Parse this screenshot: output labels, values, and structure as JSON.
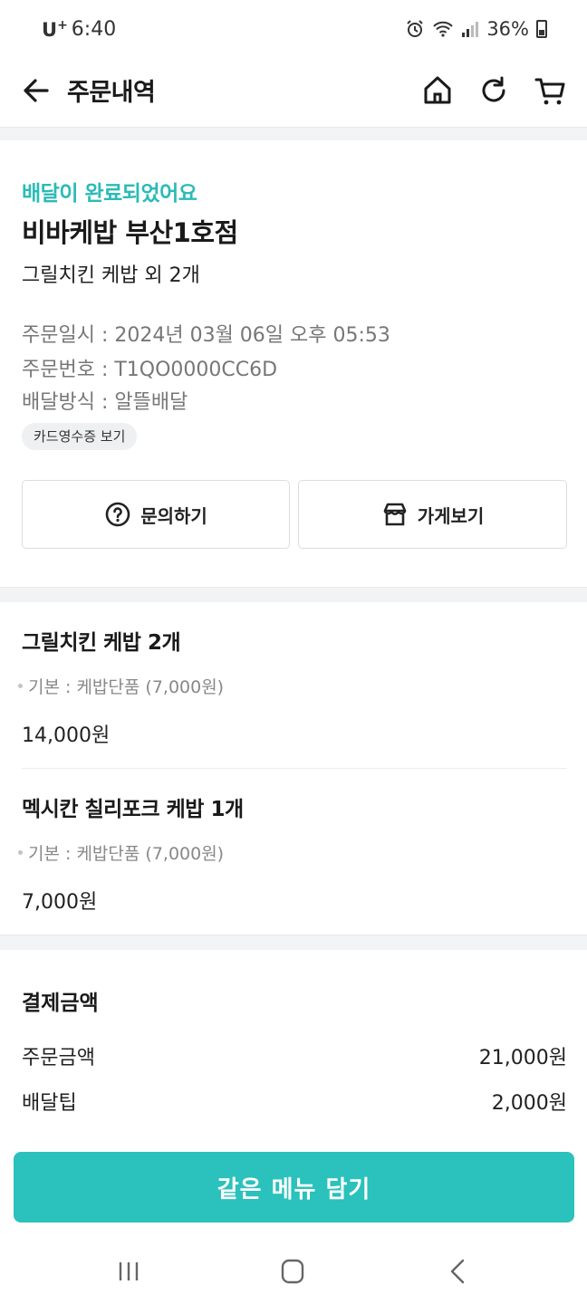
{
  "status_bar": {
    "carrier": "U",
    "carrier_plus": "+",
    "time": "6:40",
    "battery": "36%"
  },
  "header": {
    "title": "주문내역",
    "icons": [
      "back-icon",
      "home-icon",
      "refresh-icon",
      "cart-icon"
    ]
  },
  "order": {
    "status": "배달이 완료되었어요",
    "store_name": "비바케밥 부산1호점",
    "summary": "그릴치킨 케밥 외 2개",
    "info": [
      {
        "label": "주문일시 : ",
        "value": "2024년 03월 06일 오후 05:53"
      },
      {
        "label": "주문번호 : ",
        "value": "T1QO0000CC6D"
      },
      {
        "label": "배달방식 : ",
        "value": "알뜰배달"
      }
    ],
    "receipt_button": "카드영수증 보기",
    "inquiry_button": "문의하기",
    "store_button": "가게보기"
  },
  "items": [
    {
      "name": "그릴치킨 케밥 2개",
      "option": "기본 : 케밥단품 (7,000원)",
      "price": "14,000원"
    },
    {
      "name": "멕시칸 칠리포크 케밥 1개",
      "option": "기본 : 케밥단품 (7,000원)",
      "price": "7,000원"
    }
  ],
  "payment": {
    "title": "결제금액",
    "rows": [
      {
        "label": "주문금액",
        "value": "21,000원"
      },
      {
        "label": "배달팁",
        "value": "2,000원"
      }
    ]
  },
  "cta": "같은 메뉴 담기",
  "colors": {
    "accent": "#2bbbb7",
    "cta_background": "#2bc1bc",
    "band": "#f2f3f5"
  }
}
